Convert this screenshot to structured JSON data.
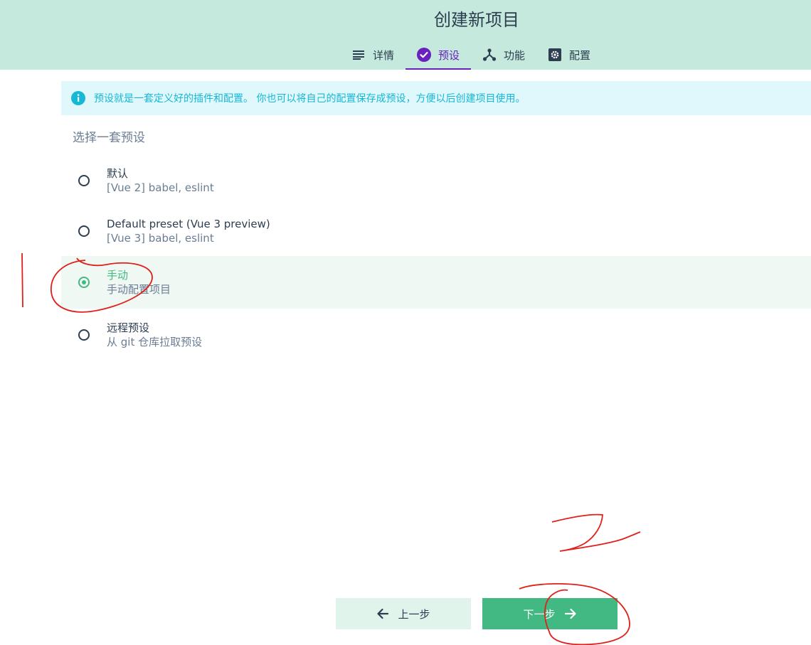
{
  "header": {
    "title": "创建新项目",
    "tabs": [
      {
        "label": "详情",
        "icon": "list-icon"
      },
      {
        "label": "预设",
        "icon": "check-circle-icon",
        "active": true
      },
      {
        "label": "功能",
        "icon": "fork-icon"
      },
      {
        "label": "配置",
        "icon": "gear-icon"
      }
    ]
  },
  "info": {
    "text": "预设就是一套定义好的插件和配置。 你也可以将自己的配置保存成预设，方便以后创建项目使用。",
    "icon": "info-icon"
  },
  "presets": {
    "title": "选择一套预设",
    "items": [
      {
        "name": "默认",
        "desc": "[Vue 2] babel, eslint",
        "selected": false
      },
      {
        "name": "Default preset (Vue 3 preview)",
        "desc": "[Vue 3] babel, eslint",
        "selected": false
      },
      {
        "name": "手动",
        "desc": "手动配置项目",
        "selected": true
      },
      {
        "name": "远程预设",
        "desc": "从 git 仓库拉取预设",
        "selected": false
      }
    ]
  },
  "footer": {
    "prev_label": "上一步",
    "next_label": "下一步"
  },
  "colors": {
    "header_bg": "#c5eadd",
    "accent_green": "#42b983",
    "active_tab": "#6a1fbf",
    "info_text": "#16b8d6",
    "annotation_red": "#e0201a"
  }
}
